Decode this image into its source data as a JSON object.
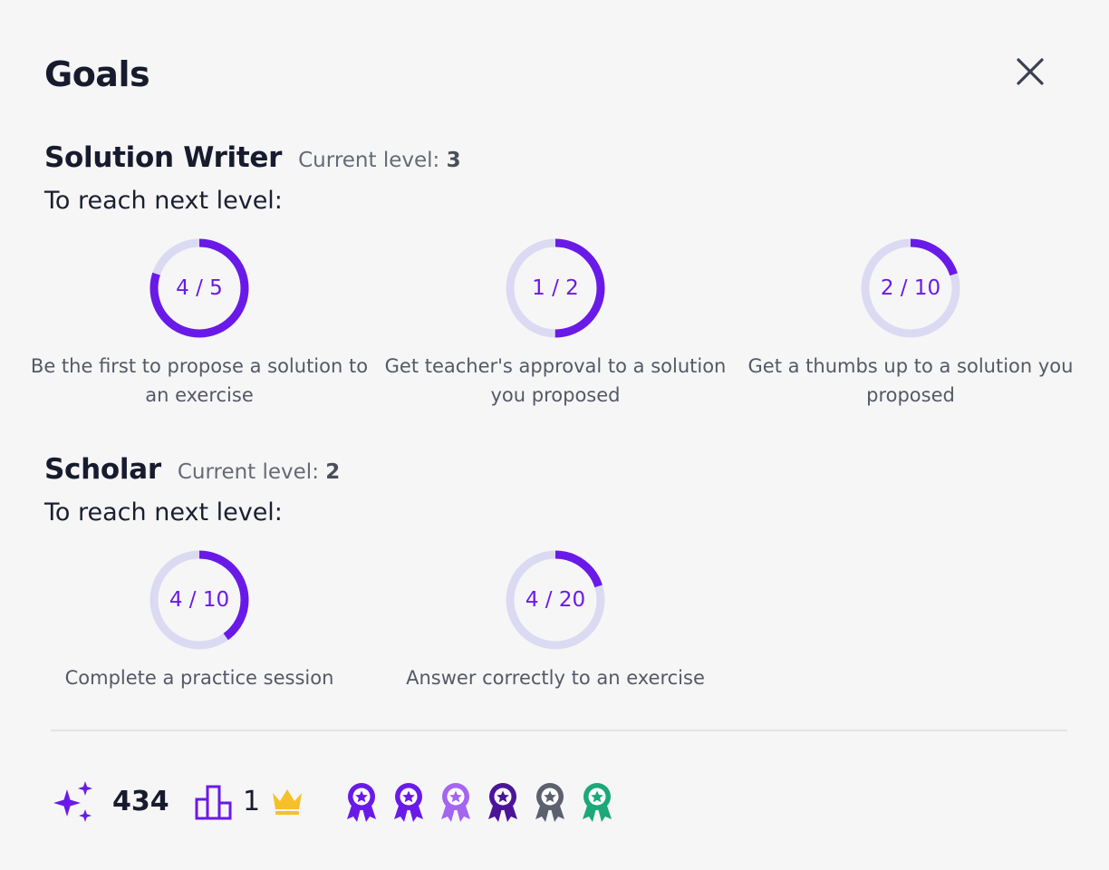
{
  "modal": {
    "title": "Goals"
  },
  "sections": [
    {
      "name": "Solution Writer",
      "level_label": "Current level:",
      "level": "3",
      "subtitle": "To reach next level:",
      "goals": [
        {
          "progress_text": "4 / 5",
          "current": 4,
          "target": 5,
          "description": "Be the first to propose a solution to an exercise"
        },
        {
          "progress_text": "1 / 2",
          "current": 1,
          "target": 2,
          "description": "Get teacher's approval to a solution you proposed"
        },
        {
          "progress_text": "2 / 10",
          "current": 2,
          "target": 10,
          "description": "Get a thumbs up to a solution you proposed"
        }
      ]
    },
    {
      "name": "Scholar",
      "level_label": "Current level:",
      "level": "2",
      "subtitle": "To reach next level:",
      "goals": [
        {
          "progress_text": "4 / 10",
          "current": 4,
          "target": 10,
          "description": "Complete a practice session"
        },
        {
          "progress_text": "4 / 20",
          "current": 4,
          "target": 20,
          "description": "Answer correctly to an exercise"
        }
      ]
    }
  ],
  "footer": {
    "points": "434",
    "points_icon": "sparkles-icon",
    "rank": "1",
    "rank_icon": "leaderboard-icon",
    "crown_icon": "crown-icon",
    "badges": [
      {
        "icon": "ribbon-badge-icon",
        "color": "#6a1ae8"
      },
      {
        "icon": "ribbon-badge-icon",
        "color": "#6a1ae8"
      },
      {
        "icon": "ribbon-badge-icon",
        "color": "#a465f0"
      },
      {
        "icon": "ribbon-badge-icon",
        "color": "#4a1598"
      },
      {
        "icon": "ribbon-badge-icon",
        "color": "#5c6170"
      },
      {
        "icon": "ribbon-badge-icon",
        "color": "#1ca878"
      }
    ]
  },
  "colors": {
    "accent": "#6a1ae8",
    "ring_track": "#dcdaf2",
    "crown": "#f5c02a"
  }
}
